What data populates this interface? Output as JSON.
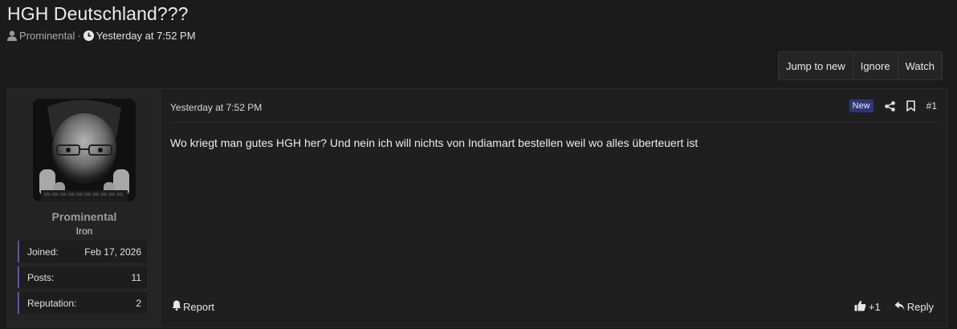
{
  "thread": {
    "title": "HGH Deutschland???",
    "author": "Prominental",
    "separator": "·",
    "date": "Yesterday at 7:52 PM"
  },
  "toolbar": {
    "jump_label": "Jump to new",
    "ignore_label": "Ignore",
    "watch_label": "Watch"
  },
  "user": {
    "name": "Prominental",
    "title": "Iron",
    "stats": {
      "joined_label": "Joined:",
      "joined_value": "Feb 17, 2026",
      "posts_label": "Posts:",
      "posts_value": "11",
      "rep_label": "Reputation:",
      "rep_value": "2"
    }
  },
  "post": {
    "date": "Yesterday at 7:52 PM",
    "badge": "New",
    "number": "#1",
    "body": "Wo kriegt man gutes HGH her? Und nein ich will nichts von Indiamart bestellen weil wo alles überteuert ist",
    "report_label": "Report",
    "like_count": "+1",
    "reply_label": "Reply"
  },
  "colors": {
    "background": "#1b1b1b",
    "panel": "#1f1f1f",
    "user_panel": "#242424",
    "stat_accent": "#5b57a8",
    "new_badge": "#2c3873"
  },
  "icons": [
    "user-icon",
    "clock-icon",
    "share-icon",
    "bookmark-icon",
    "bell-icon",
    "thumbs-up-icon",
    "reply-icon"
  ]
}
